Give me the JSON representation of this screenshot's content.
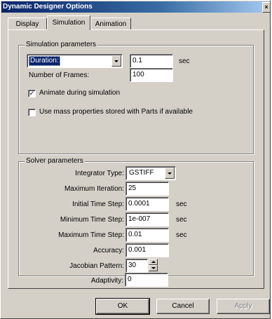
{
  "window": {
    "title": "Dynamic Designer Options",
    "close_glyph": "×"
  },
  "tabs": [
    {
      "label": "Display",
      "active": false
    },
    {
      "label": "Simulation",
      "active": true
    },
    {
      "label": "Animation",
      "active": false
    }
  ],
  "simulation": {
    "group_label": "Simulation parameters",
    "duration_select": "Duration:",
    "duration_value": "0.1",
    "duration_unit": "sec",
    "frames_label": "Number of Frames:",
    "frames_value": "100",
    "animate_label": "Animate during simulation",
    "animate_checked": true,
    "mass_label": "Use mass properties stored with Parts if available",
    "mass_checked": false
  },
  "solver": {
    "group_label": "Solver parameters",
    "integrator_label": "Integrator Type:",
    "integrator_value": "GSTIFF",
    "max_iter_label": "Maximum Iteration:",
    "max_iter_value": "25",
    "initial_step_label": "Initial Time Step:",
    "initial_step_value": "0.0001",
    "initial_step_unit": "sec",
    "min_step_label": "Minimum Time Step:",
    "min_step_value": "1e-007",
    "min_step_unit": "sec",
    "max_step_label": "Maximum Time Step:",
    "max_step_value": "0.01",
    "max_step_unit": "sec",
    "accuracy_label": "Accuracy:",
    "accuracy_value": "0.001",
    "jacobian_label": "Jacobian Pattern:",
    "jacobian_value": "30",
    "adaptivity_label": "Adaptivity:",
    "adaptivity_value": "0"
  },
  "buttons": {
    "ok": "OK",
    "cancel": "Cancel",
    "apply": "Apply"
  },
  "colors": {
    "titlebar": "#0a246a",
    "face": "#d4d0c8",
    "selection": "#0a246a"
  }
}
